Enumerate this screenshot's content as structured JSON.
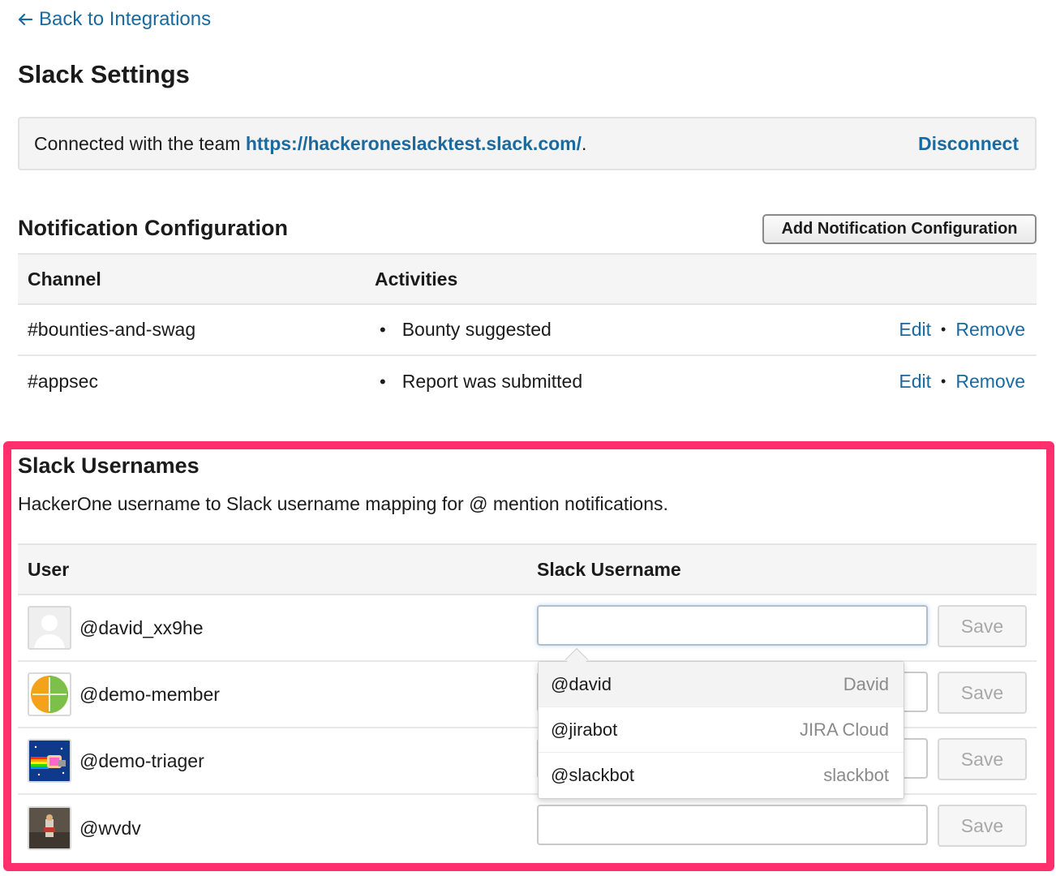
{
  "back_link": {
    "icon": "arrow-left-icon",
    "label": "Back to Integrations"
  },
  "page_title": "Slack Settings",
  "connection": {
    "prefix": "Connected with the team ",
    "team_url": "https://hackeroneslacktest.slack.com/",
    "suffix": ".",
    "disconnect_label": "Disconnect"
  },
  "notifications": {
    "title": "Notification Configuration",
    "add_button_label": "Add Notification Configuration",
    "columns": [
      "Channel",
      "Activities"
    ],
    "rows": [
      {
        "channel": "#bounties-and-swag",
        "activity": "Bounty suggested",
        "edit": "Edit",
        "remove": "Remove"
      },
      {
        "channel": "#appsec",
        "activity": "Report was submitted",
        "edit": "Edit",
        "remove": "Remove"
      }
    ]
  },
  "usernames": {
    "title": "Slack Usernames",
    "description": "HackerOne username to Slack username mapping for @ mention notifications.",
    "columns": [
      "User",
      "Slack Username"
    ],
    "save_label": "Save",
    "rows": [
      {
        "username": "@david_xx9he",
        "avatar": "default-avatar-icon",
        "slack_value": ""
      },
      {
        "username": "@demo-member",
        "avatar": "orange-green-avatar",
        "slack_value": ""
      },
      {
        "username": "@demo-triager",
        "avatar": "nyan-cat-avatar",
        "slack_value": ""
      },
      {
        "username": "@wvdv",
        "avatar": "photo-avatar",
        "slack_value": ""
      }
    ]
  },
  "autocomplete": {
    "items": [
      {
        "handle": "@david",
        "name": "David"
      },
      {
        "handle": "@jirabot",
        "name": "JIRA Cloud"
      },
      {
        "handle": "@slackbot",
        "name": "slackbot"
      }
    ]
  },
  "colors": {
    "link": "#1a6aa0",
    "danger": "#d0242e",
    "highlight_border": "#ff2f6e"
  }
}
